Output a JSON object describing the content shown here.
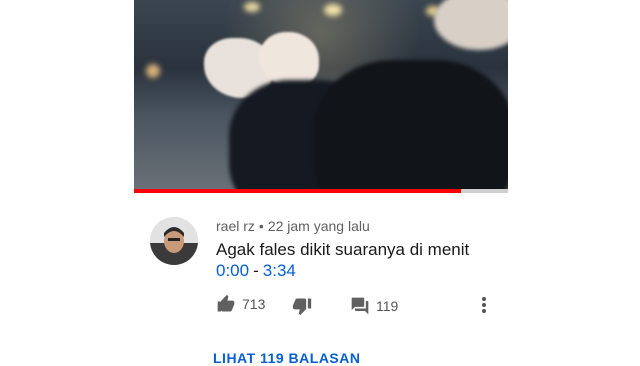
{
  "video": {
    "progress_fraction": 0.874,
    "progress_color": "#ff0000",
    "track_color": "#cfcfcf"
  },
  "comment": {
    "author": "rael rz",
    "separator": "•",
    "time": "22 jam yang lalu",
    "text": "Agak fales dikit suaranya di menit",
    "timestamp_start": "0:00",
    "timestamp_sep": "-",
    "timestamp_end": "3:34",
    "link_color": "#065fd4"
  },
  "actions": {
    "like_icon": "thumb-up-icon",
    "like_count": "713",
    "dislike_icon": "thumb-down-icon",
    "reply_icon": "comment-icon",
    "reply_count": "119",
    "more_icon": "more-vertical-icon"
  },
  "replies_link": "LIHAT 119 BALASAN"
}
